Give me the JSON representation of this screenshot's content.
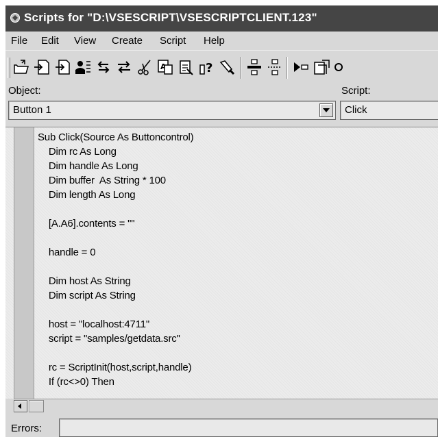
{
  "window": {
    "title": "Scripts for \"D:\\VSESCRIPT\\VSESCRIPTCLIENT.123\""
  },
  "menu": [
    "File",
    "Edit",
    "View",
    "Create",
    "Script",
    "Help"
  ],
  "toolbar": {
    "buttons": [
      "open-script-icon",
      "import-icon",
      "export-icon",
      "user-list-icon",
      "undo-icon",
      "redo-icon",
      "cut-icon",
      "find-icon",
      "replace-icon",
      "help-icon",
      "flashlight-icon",
      "insert-above-icon",
      "insert-below-icon",
      "run-icon",
      "debug-icon"
    ]
  },
  "object": {
    "label": "Object:",
    "value": "Button 1"
  },
  "script": {
    "label": "Script:",
    "value": "Click"
  },
  "code": {
    "lines": [
      "Sub Click(Source As Buttoncontrol)",
      "    Dim rc As Long",
      "    Dim handle As Long",
      "    Dim buffer  As String * 100",
      "    Dim length As Long",
      "",
      "    [A.A6].contents = \"\"",
      "",
      "    handle = 0",
      "",
      "    Dim host As String",
      "    Dim script As String",
      "",
      "    host = \"localhost:4711\"",
      "    script = \"samples/getdata.src\"",
      "",
      "    rc = ScriptInit(host,script,handle)",
      "    If (rc<>0) Then"
    ]
  },
  "errors": {
    "label": "Errors:",
    "value": ""
  },
  "colors": {
    "titlebar": "#454545",
    "chrome": "#d8d8d8",
    "editor": "#ececec"
  }
}
